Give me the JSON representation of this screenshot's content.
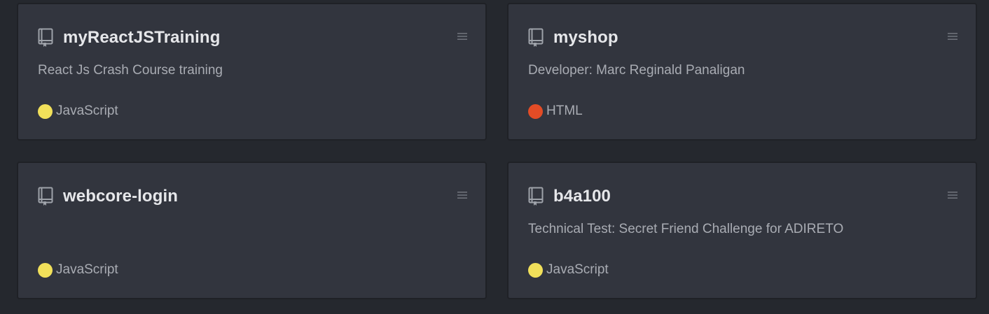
{
  "repos": [
    {
      "name": "myReactJSTraining",
      "description": "React Js Crash Course training",
      "language": "JavaScript",
      "language_color": "#f1e05a"
    },
    {
      "name": "myshop",
      "description": "Developer: Marc Reginald Panaligan",
      "language": "HTML",
      "language_color": "#e34c26"
    },
    {
      "name": "webcore-login",
      "description": "",
      "language": "JavaScript",
      "language_color": "#f1e05a"
    },
    {
      "name": "b4a100",
      "description": "Technical Test: Secret Friend Challenge for ADIRETO",
      "language": "JavaScript",
      "language_color": "#f1e05a"
    }
  ],
  "icons": {
    "repo": "repo-book-icon",
    "menu": "hamburger-menu-icon"
  },
  "colors": {
    "page_background": "#25282e",
    "card_background": "#32353e",
    "title_text": "#e6e7ea",
    "secondary_text": "#a9acb3"
  }
}
